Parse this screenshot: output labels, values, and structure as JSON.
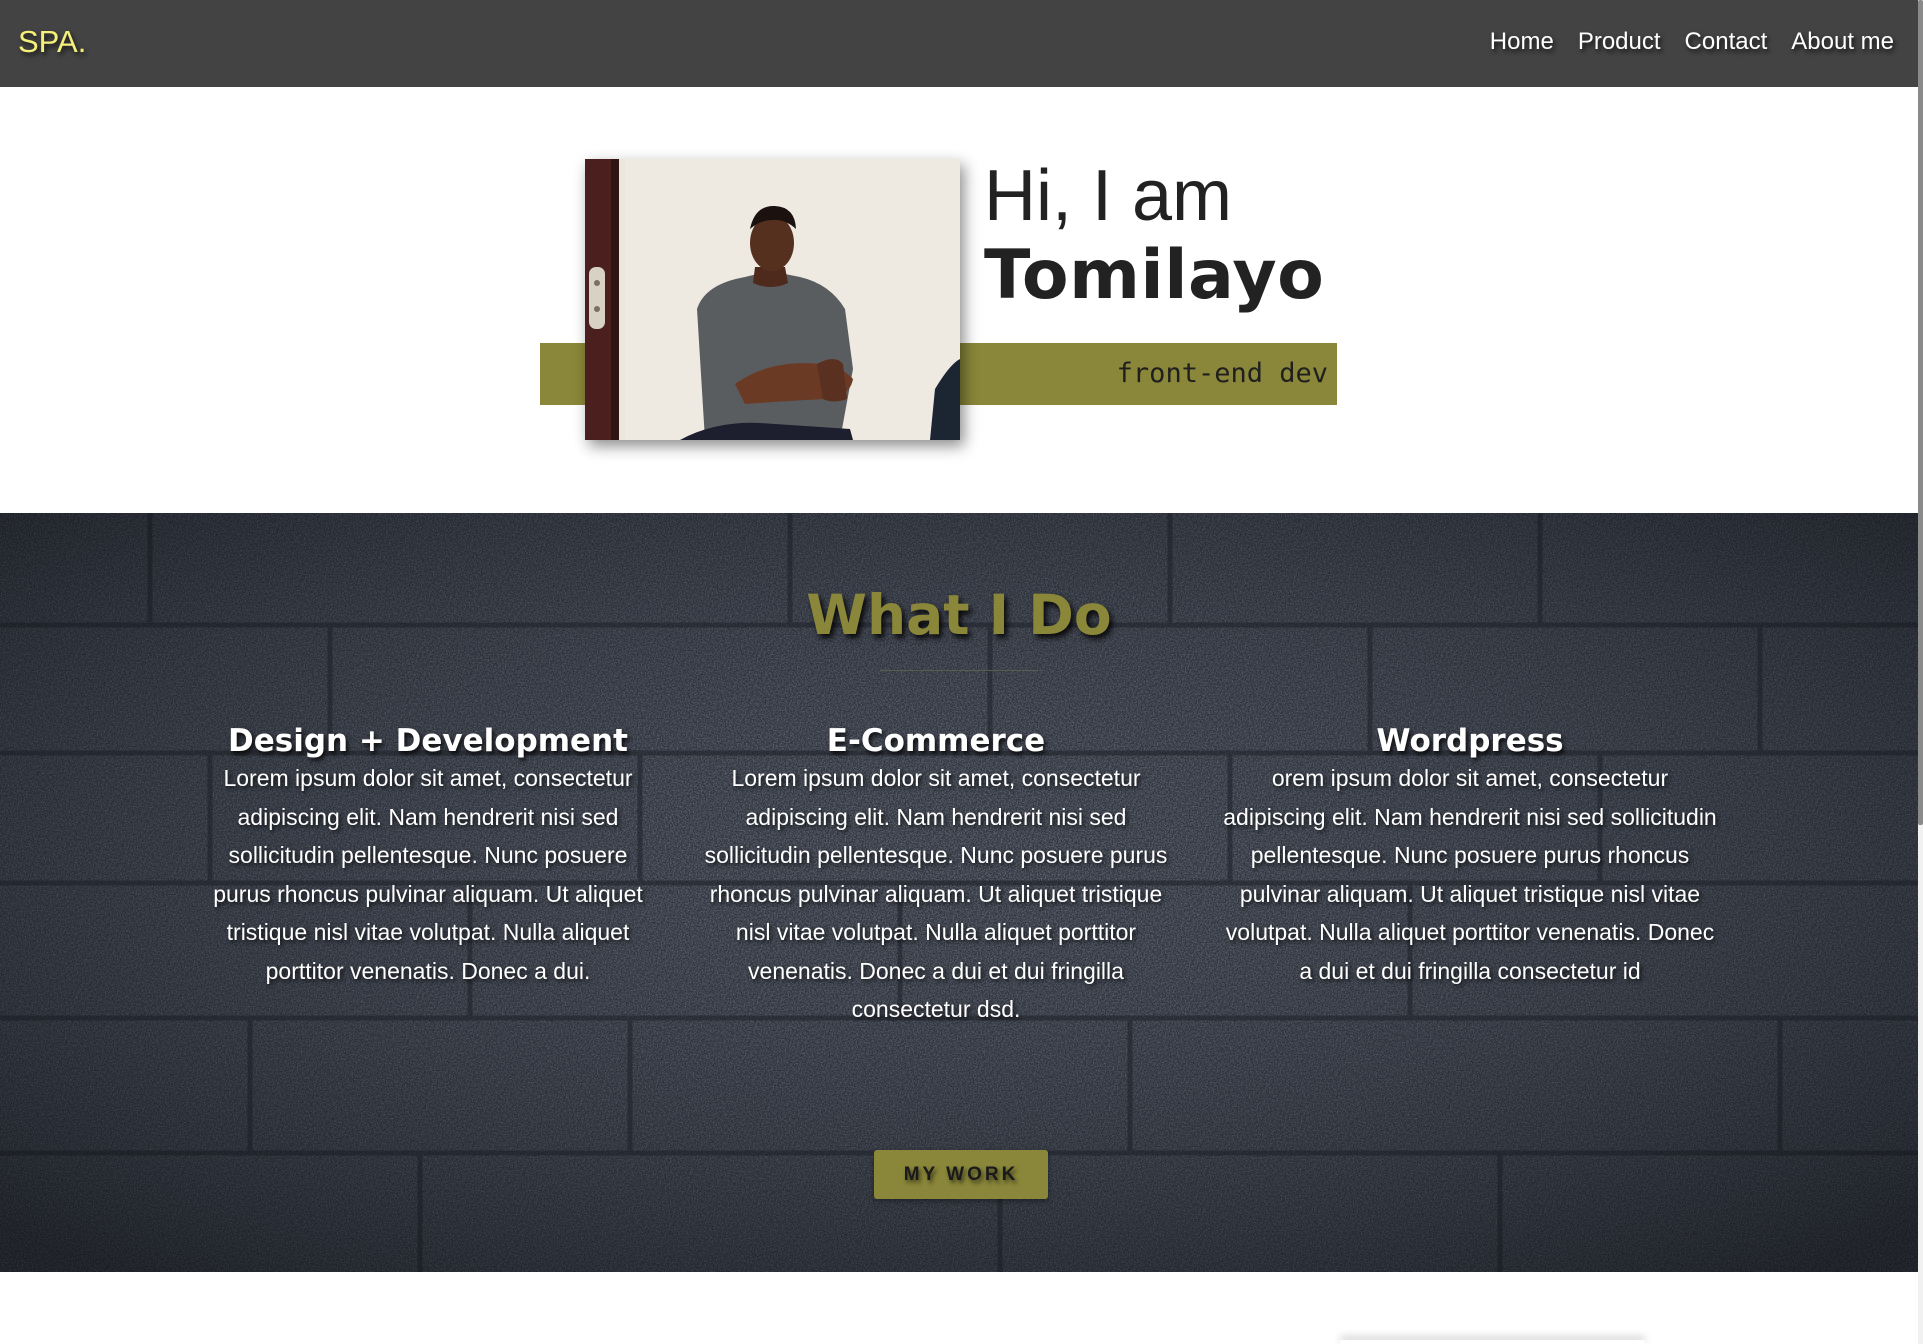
{
  "brand": "SPA.",
  "nav": {
    "items": [
      {
        "label": "Home"
      },
      {
        "label": "Product"
      },
      {
        "label": "Contact"
      },
      {
        "label": "About me"
      }
    ]
  },
  "hero": {
    "greeting": "Hi, I am",
    "name": "Tomilayo",
    "tagline": "front-end dev"
  },
  "services": {
    "title": "What I Do",
    "items": [
      {
        "title": "Design + Development",
        "body": "Lorem ipsum dolor sit amet, consectetur adipiscing elit. Nam hendrerit nisi sed sollicitudin pellentesque. Nunc posuere purus rhoncus pulvinar aliquam. Ut aliquet tristique nisl vitae volutpat. Nulla aliquet porttitor venenatis. Donec a dui."
      },
      {
        "title": "E-Commerce",
        "body": "Lorem ipsum dolor sit amet, consectetur adipiscing elit. Nam hendrerit nisi sed sollicitudin pellentesque. Nunc posuere purus rhoncus pulvinar aliquam. Ut aliquet tristique nisl vitae volutpat. Nulla aliquet porttitor venenatis. Donec a dui et dui fringilla consectetur dsd."
      },
      {
        "title": "Wordpress",
        "body": "orem ipsum dolor sit amet, consectetur adipiscing elit. Nam hendrerit nisi sed sollicitudin pellentesque. Nunc posuere purus rhoncus pulvinar aliquam. Ut aliquet tristique nisl vitae volutpat. Nulla aliquet porttitor venenatis. Donec a dui et dui fringilla consectetur id"
      }
    ],
    "button_label": "MY WORK"
  },
  "colors": {
    "navbar": "#434343",
    "brand": "#f4f07a",
    "accent_olive": "#8a873a",
    "services_bg": "#282d36",
    "text_dark": "#222222"
  }
}
